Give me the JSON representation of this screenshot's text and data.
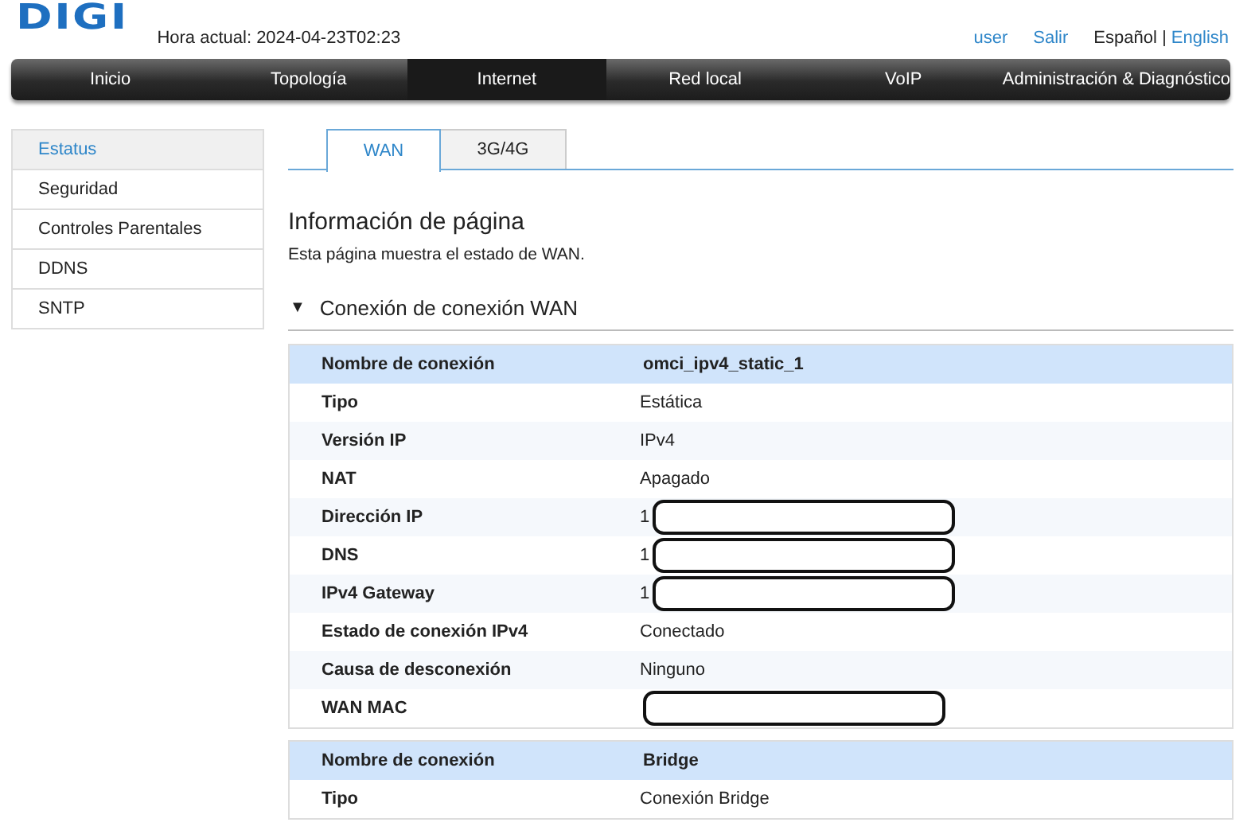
{
  "header": {
    "logo": "DIGI",
    "time": "Hora actual: 2024-04-23T02:23",
    "links": [
      {
        "label": "user"
      },
      {
        "label": "Salir"
      }
    ],
    "languages": [
      {
        "label": "Español",
        "selected": true
      },
      {
        "label": "English",
        "selected": false
      }
    ]
  },
  "nav": [
    {
      "label": "Inicio",
      "selected": false
    },
    {
      "label": "Topología",
      "selected": false
    },
    {
      "label": "Internet",
      "selected": true
    },
    {
      "label": "Red local",
      "selected": false
    },
    {
      "label": "VoIP",
      "selected": false
    },
    {
      "label": "Administración & Diagnóstico",
      "selected": false
    }
  ],
  "sidebar": {
    "items": [
      {
        "label": "Estatus",
        "selected": true
      },
      {
        "label": "Seguridad",
        "selected": false
      },
      {
        "label": "Controles Parentales",
        "selected": false
      },
      {
        "label": "DDNS",
        "selected": false
      },
      {
        "label": "SNTP",
        "selected": false
      }
    ]
  },
  "tabs": [
    {
      "label": "WAN",
      "selected": true
    },
    {
      "label": "3G/4G",
      "selected": false
    }
  ],
  "page_title": "Información de página",
  "page_description": "Esta página muestra el estado de WAN.",
  "section": {
    "title": "Conexión de conexión WAN",
    "expanded": true,
    "expander": "▼"
  },
  "connections": [
    {
      "rows": [
        {
          "label": "Nombre de conexión",
          "value": "omci_ipv4_static_1",
          "kind": "header"
        },
        {
          "label": "Tipo",
          "value": "Estática",
          "kind": "plain"
        },
        {
          "label": "Versión IP",
          "value": "IPv4",
          "kind": "plain"
        },
        {
          "label": "NAT",
          "value": "Apagado",
          "kind": "plain"
        },
        {
          "label": "Dirección IP",
          "value": "1",
          "kind": "redacted"
        },
        {
          "label": "DNS",
          "value": "1",
          "kind": "redacted"
        },
        {
          "label": "IPv4 Gateway",
          "value": "1",
          "kind": "redacted"
        },
        {
          "label": "Estado de conexión IPv4",
          "value": "Conectado",
          "kind": "plain"
        },
        {
          "label": "Causa de desconexión",
          "value": "Ninguno",
          "kind": "plain"
        },
        {
          "label": "WAN MAC",
          "kind": "redacted"
        }
      ]
    },
    {
      "rows": [
        {
          "label": "Nombre de conexión",
          "value": "Bridge",
          "kind": "header"
        },
        {
          "label": "Tipo",
          "value": "Conexión Bridge",
          "kind": "plain"
        }
      ]
    }
  ]
}
